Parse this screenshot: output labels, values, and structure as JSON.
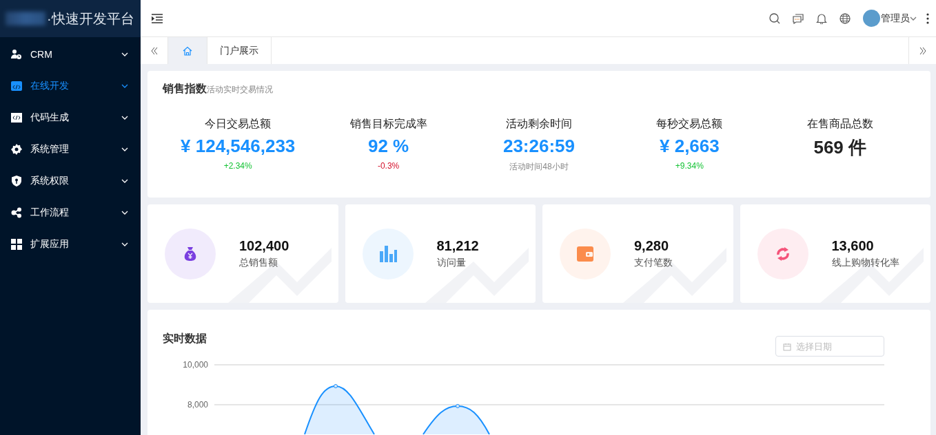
{
  "sidebar": {
    "logo_text": "·快速开发平台",
    "items": [
      {
        "label": "CRM",
        "selected": false
      },
      {
        "label": "在线开发",
        "selected": true
      },
      {
        "label": "代码生成",
        "selected": false
      },
      {
        "label": "系统管理",
        "selected": false
      },
      {
        "label": "系统权限",
        "selected": false
      },
      {
        "label": "工作流程",
        "selected": false
      },
      {
        "label": "扩展应用",
        "selected": false
      }
    ]
  },
  "header": {
    "user_name": "管理员"
  },
  "tabs": [
    {
      "kind": "home",
      "selected": true
    },
    {
      "label": "门户展示",
      "kind": "page",
      "selected": false
    }
  ],
  "sales_index": {
    "title": "销售指数",
    "subtitle": "活动实时交易情况",
    "metrics": [
      {
        "label": "今日交易总额",
        "value": "¥ 124,546,233",
        "kind": "accent",
        "note": "+2.34%",
        "color": "#13c233"
      },
      {
        "label": "销售目标完成率",
        "value": "92 %",
        "kind": "accent",
        "note": "-0.3%",
        "color": "#d4102a"
      },
      {
        "label": "活动剩余时间",
        "value": "23:26:59",
        "kind": "accent",
        "note": "活动时间48小时",
        "color": "#888888"
      },
      {
        "label": "每秒交易总额",
        "value": "¥ 2,663",
        "kind": "accent",
        "note": "+9.34%",
        "color": "#13c233"
      },
      {
        "label": "在售商品总数",
        "value": "569 件",
        "kind": "plain"
      }
    ]
  },
  "stat_cards": [
    {
      "value": "102,400",
      "label": "总销售额",
      "color": "#7a3fe0"
    },
    {
      "value": "81,212",
      "label": "访问量",
      "color": "#4aa8f8"
    },
    {
      "value": "9,280",
      "label": "支付笔数",
      "color": "#fb8c4c"
    },
    {
      "value": "13,600",
      "label": "线上购物转化率",
      "color": "#f5537a"
    }
  ],
  "realtime": {
    "title": "实时数据",
    "date_placeholder": "选择日期",
    "axis_labels": [
      "10,000",
      "8,000"
    ]
  }
}
